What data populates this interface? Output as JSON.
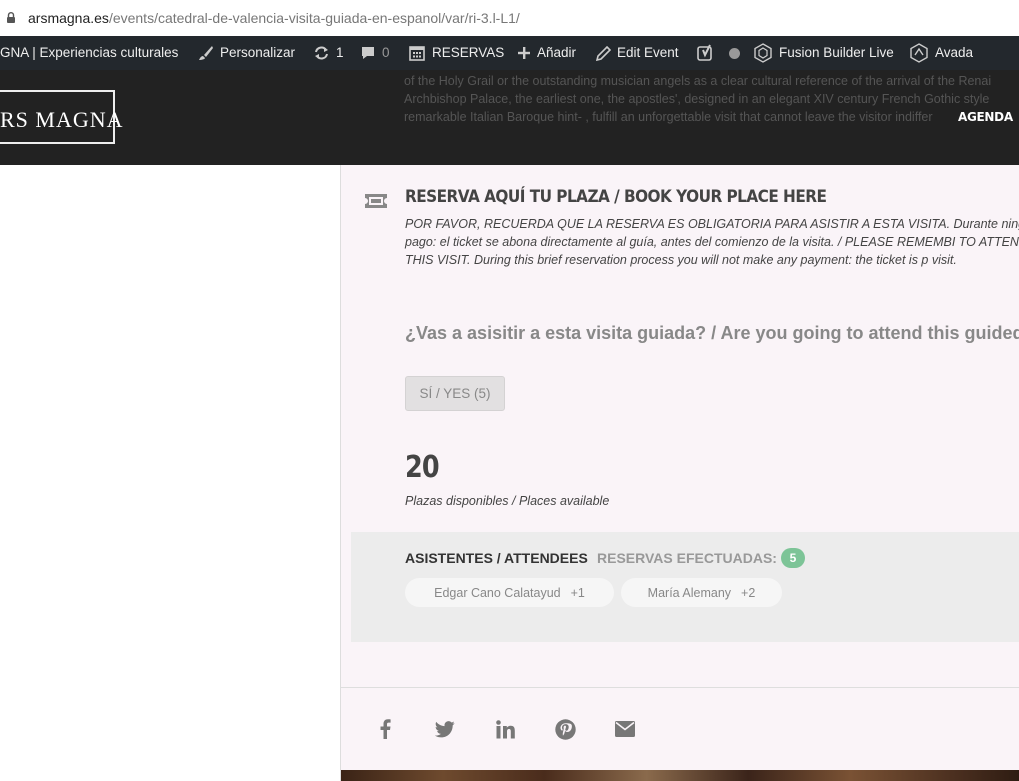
{
  "browser": {
    "url_host": "arsmagna.es",
    "url_path": "/events/catedral-de-valencia-visita-guiada-en-espanol/var/ri-3.l-L1/"
  },
  "adminbar": {
    "site_name": "GNA | Experiencias culturales",
    "customize": "Personalizar",
    "updates_count": "1",
    "comments_count": "0",
    "reservas": "RESERVAS",
    "add_new": "Añadir",
    "edit_event": "Edit Event",
    "fusion_builder": "Fusion Builder Live",
    "avada": "Avada"
  },
  "header": {
    "logo_text": "RS MAGNA",
    "overlay_lines": [
      "of the Holy Grail or the outstanding musician angels as a clear cultural reference of the arrival of the Renai",
      "Archbishop Palace, the earliest one, the apostles', designed in an elegant XIV century French Gothic style",
      "remarkable Italian Baroque hint- , fulfill an unforgettable visit that cannot leave the visitor indiffer"
    ],
    "nav_agenda": "AGENDA"
  },
  "rsvp": {
    "title": "RESERVA AQUÍ TU PLAZA / BOOK YOUR PLACE HERE",
    "description": "POR FAVOR, RECUERDA QUE LA RESERVA ES OBLIGATORIA PARA ASISTIR A ESTA VISITA. Durante ningún pago: el ticket se abona directamente al guía, antes del comienzo de la visita. / PLEASE REMEMBI TO ATTEND THIS VISIT. During this brief reservation process you will not make any payment: the ticket is p visit.",
    "question": "¿Vas a asisitir a esta visita guiada? / Are you going to attend this guided",
    "yes_button": "SÍ / YES (5)",
    "places_count": "20",
    "places_label": "Plazas disponibles / Places available"
  },
  "attendees": {
    "title": "ASISTENTES / ATTENDEES",
    "reservations_label": "RESERVAS EFECTUADAS:",
    "reservations_count": "5",
    "list": [
      {
        "name": "Edgar Cano Calatayud",
        "extra": "+1"
      },
      {
        "name": "María Alemany",
        "extra": "+2"
      }
    ]
  },
  "share": {
    "icons": [
      "facebook-icon",
      "twitter-icon",
      "linkedin-icon",
      "pinterest-icon",
      "email-icon"
    ]
  },
  "colors": {
    "adminbar_bg": "#23282d",
    "header_bg": "#222222",
    "content_bg": "#faf4f8",
    "badge_green": "#7dc497"
  }
}
